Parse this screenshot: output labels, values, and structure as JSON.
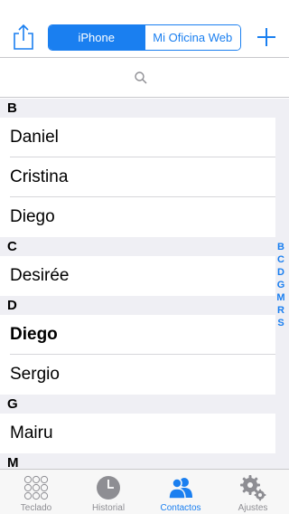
{
  "colors": {
    "accent": "#1a7ff0",
    "inactive": "#8e8e93",
    "section_bg": "#efeff4"
  },
  "nav": {
    "segments": [
      {
        "label": "iPhone",
        "selected": true
      },
      {
        "label": "Mi Oficina Web",
        "selected": false
      }
    ]
  },
  "contacts": {
    "sections": [
      {
        "letter": "B",
        "rows": [
          {
            "name": "Daniel"
          },
          {
            "name": "Cristina"
          },
          {
            "name": "Diego"
          }
        ]
      },
      {
        "letter": "C",
        "rows": [
          {
            "name": "Desirée"
          }
        ]
      },
      {
        "letter": "D",
        "rows": [
          {
            "name": "Diego",
            "bold": true
          },
          {
            "name": "Sergio"
          }
        ]
      },
      {
        "letter": "G",
        "rows": [
          {
            "name": "Mairu"
          }
        ]
      },
      {
        "letter": "M",
        "rows": []
      }
    ]
  },
  "index_letters": [
    "B",
    "C",
    "D",
    "G",
    "M",
    "R",
    "S"
  ],
  "tabbar": {
    "tabs": [
      {
        "label": "Teclado",
        "icon": "keypad-icon",
        "active": false
      },
      {
        "label": "Historial",
        "icon": "clock-icon",
        "active": false
      },
      {
        "label": "Contactos",
        "icon": "contacts-icon",
        "active": true
      },
      {
        "label": "Ajustes",
        "icon": "gear-icon",
        "active": false
      }
    ]
  }
}
